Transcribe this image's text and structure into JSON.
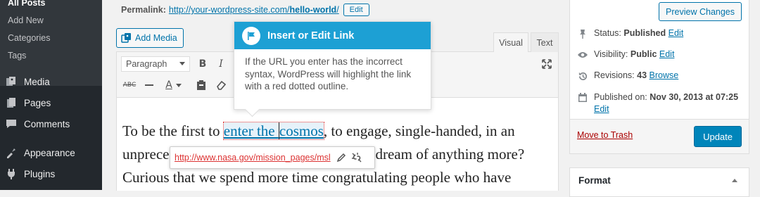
{
  "sidebar": {
    "submenu": [
      "All Posts",
      "Add New",
      "Categories",
      "Tags"
    ],
    "items": [
      {
        "label": "Media",
        "icon": "media-icon"
      },
      {
        "label": "Pages",
        "icon": "pages-icon"
      },
      {
        "label": "Comments",
        "icon": "comments-icon"
      },
      {
        "label": "Appearance",
        "icon": "appearance-icon"
      },
      {
        "label": "Plugins",
        "icon": "plugins-icon"
      }
    ]
  },
  "permalink": {
    "label": "Permalink:",
    "base": "http://your-wordpress-site.com/",
    "slug": "hello-world",
    "trail": "/",
    "edit_label": "Edit"
  },
  "editor": {
    "add_media_label": "Add Media",
    "tabs": {
      "visual": "Visual",
      "text": "Text"
    },
    "format_select": "Paragraph",
    "content": {
      "line1_before": "To be the first to ",
      "line1_link_a": "enter the ",
      "line1_link_b": "cosmos",
      "line1_after": ", to engage, single-handed, in an",
      "line2_before": "unprece",
      "line2_after": "dream of anything more?",
      "line3": "Curious that we spend more time congratulating people who have"
    },
    "link_popup_url": "http://www.nasa.gov/mission_pages/msl"
  },
  "callout": {
    "title": "Insert or Edit Link",
    "body": "If the URL you enter has the incorrect syntax, WordPress will highlight the link with a red dotted outline."
  },
  "publish": {
    "preview_label": "Preview Changes",
    "status_label": "Status:",
    "status_value": "Published",
    "visibility_label": "Visibility:",
    "visibility_value": "Public",
    "revisions_label": "Revisions:",
    "revisions_value": "43",
    "browse_label": "Browse",
    "published_label": "Published on:",
    "published_value": "Nov 30, 2013 at 07:25",
    "edit_label": "Edit",
    "trash_label": "Move to Trash",
    "update_label": "Update"
  },
  "format_box": {
    "title": "Format"
  },
  "colors": {
    "accent": "#0073aa",
    "callout": "#1da0d4",
    "error": "#dc3232",
    "sidebar": "#23282d"
  }
}
